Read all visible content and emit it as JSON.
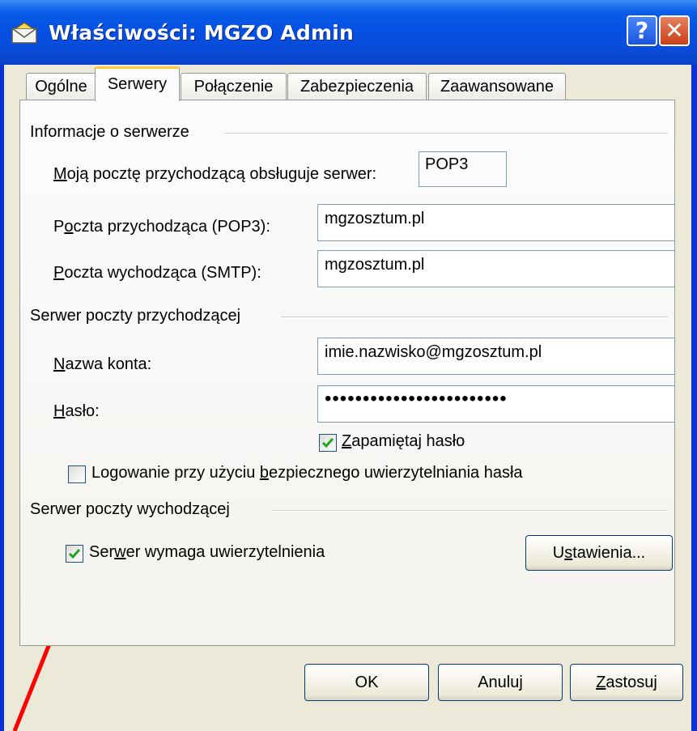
{
  "window": {
    "title": "Właściwości: MGZO Admin",
    "help_label": "?",
    "close_label": "✕"
  },
  "tabs": [
    {
      "label": "Ogólne",
      "active": false
    },
    {
      "label": "Serwery",
      "active": true
    },
    {
      "label": "Połączenie",
      "active": false
    },
    {
      "label": "Zabezpieczenia",
      "active": false
    },
    {
      "label": "Zaawansowane",
      "active": false
    }
  ],
  "server_info": {
    "group_label": "Informacje o serwerze",
    "incoming_type_label_u": "M",
    "incoming_type_label_rest": "oją pocztę przychodzącą obsługuje serwer:",
    "incoming_type_value": "POP3",
    "incoming_label_pre": "P",
    "incoming_label_u": "o",
    "incoming_label_rest": "czta przychodząca (POP3):",
    "incoming_value": "mgzosztum.pl",
    "outgoing_label_u": "P",
    "outgoing_label_rest": "oczta wychodząca (SMTP):",
    "outgoing_value": "mgzosztum.pl"
  },
  "incoming_server": {
    "group_label": "Serwer poczty przychodzącej",
    "account_label_u": "N",
    "account_label_rest": "azwa konta:",
    "account_value": "imie.nazwisko@mgzosztum.pl",
    "password_label_u": "H",
    "password_label_rest": "asło:",
    "password_value": "••••••••••••••••••••••••",
    "remember_u": "Z",
    "remember_rest": "apamiętaj hasło",
    "remember_checked": true,
    "spa_pre": "Logowanie przy użyciu ",
    "spa_u": "b",
    "spa_rest": "ezpiecznego uwierzytelniania hasła",
    "spa_checked": false
  },
  "outgoing_server": {
    "group_label": "Serwer poczty wychodzącej",
    "auth_pre": "Ser",
    "auth_u": "w",
    "auth_rest": "er wymaga uwierzytelnienia",
    "auth_checked": true,
    "settings_pre": "U",
    "settings_u": "s",
    "settings_rest": "tawienia..."
  },
  "buttons": {
    "ok": "OK",
    "cancel": "Anuluj",
    "apply_u": "Z",
    "apply_rest": "astosuj"
  },
  "colors": {
    "titlebar": "#0a5ee8",
    "annotation_arrow": "#ff0000",
    "checkmark": "#21a121"
  }
}
